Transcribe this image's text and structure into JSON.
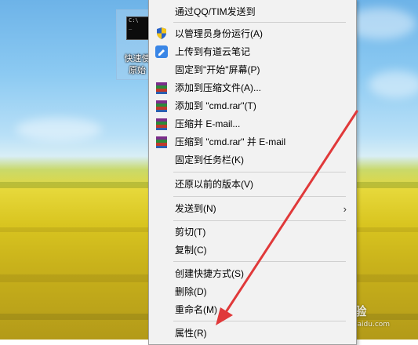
{
  "desktop": {
    "icon": {
      "name": "cmd-shortcut",
      "label": "快速使\n原始"
    }
  },
  "menu": {
    "items": [
      {
        "label": "通过QQ/TIM发送到",
        "icon": "none"
      },
      {
        "label": "以管理员身份运行(A)",
        "icon": "uac-shield-icon"
      },
      {
        "label": "上传到有道云笔记",
        "icon": "youdao-note-icon"
      },
      {
        "label": "固定到\"开始\"屏幕(P)",
        "icon": "none"
      },
      {
        "label": "添加到压缩文件(A)...",
        "icon": "winrar-icon"
      },
      {
        "label": "添加到 \"cmd.rar\"(T)",
        "icon": "winrar-icon"
      },
      {
        "label": "压缩并 E-mail...",
        "icon": "winrar-icon"
      },
      {
        "label": "压缩到 \"cmd.rar\" 并 E-mail",
        "icon": "winrar-icon"
      },
      {
        "label": "固定到任务栏(K)",
        "icon": "none"
      },
      {
        "label": "还原以前的版本(V)",
        "icon": "none"
      },
      {
        "label": "发送到(N)",
        "icon": "none",
        "submenu": true
      },
      {
        "label": "剪切(T)",
        "icon": "none"
      },
      {
        "label": "复制(C)",
        "icon": "none"
      },
      {
        "label": "创建快捷方式(S)",
        "icon": "none"
      },
      {
        "label": "删除(D)",
        "icon": "none"
      },
      {
        "label": "重命名(M)",
        "icon": "none"
      },
      {
        "label": "属性(R)",
        "icon": "none"
      }
    ],
    "submenu_arrow": "›"
  },
  "watermark": {
    "text": "Bai经验",
    "url": "jingyan.baidu.com"
  },
  "colors": {
    "menu_bg": "#f2f2f2",
    "arrow": "#e0393a"
  }
}
